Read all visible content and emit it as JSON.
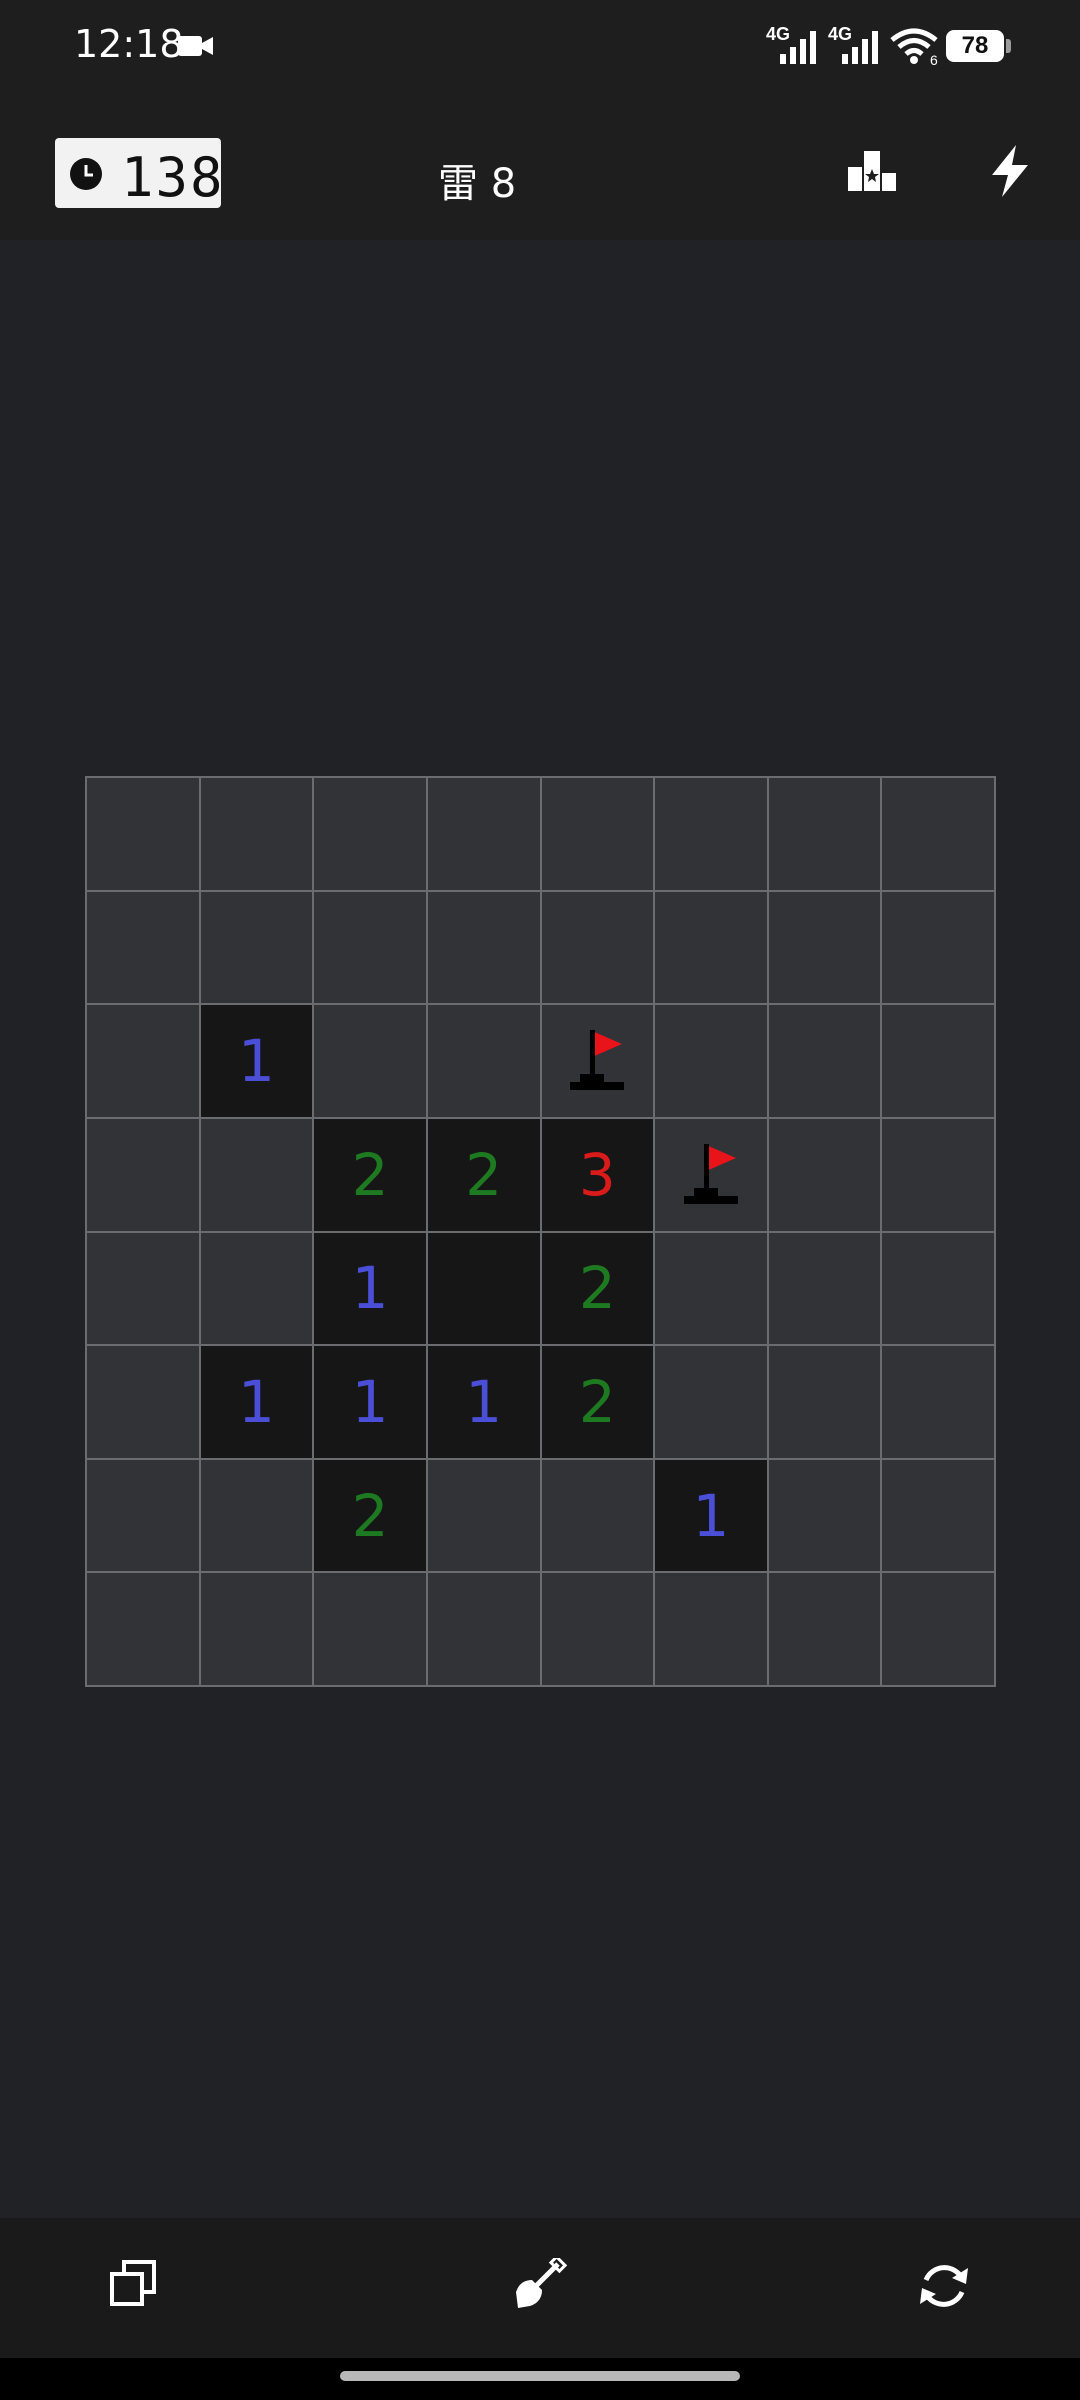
{
  "status_bar": {
    "time": "12:18",
    "network1": "4G",
    "network2": "4G",
    "wifi_badge": "6",
    "battery": "78"
  },
  "toolbar": {
    "timer": "138",
    "mine_counter": "雷 8"
  },
  "board": {
    "rows": 8,
    "cols": 8,
    "cells": [
      [
        "",
        "",
        "",
        "",
        "",
        "",
        "",
        ""
      ],
      [
        "",
        "",
        "",
        "",
        "",
        "",
        "",
        ""
      ],
      [
        "",
        "1",
        "",
        "",
        "F",
        "",
        "",
        ""
      ],
      [
        "",
        "",
        "2",
        "2",
        "3",
        "F",
        "",
        ""
      ],
      [
        "",
        "",
        "1",
        "0",
        "2",
        "",
        "",
        ""
      ],
      [
        "",
        "1",
        "1",
        "1",
        "2",
        "",
        "",
        ""
      ],
      [
        "",
        "",
        "2",
        "",
        "",
        "1",
        "",
        ""
      ],
      [
        "",
        "",
        "",
        "",
        "",
        "",
        "",
        ""
      ]
    ],
    "number_colors": {
      "1": "#4b4fd8",
      "2": "#1e7a21",
      "3": "#d91b1b"
    },
    "flag_color": "#e8141a"
  },
  "bottom_bar": {
    "icons": [
      "copy-icon",
      "shovel-icon",
      "restart-icon"
    ]
  }
}
